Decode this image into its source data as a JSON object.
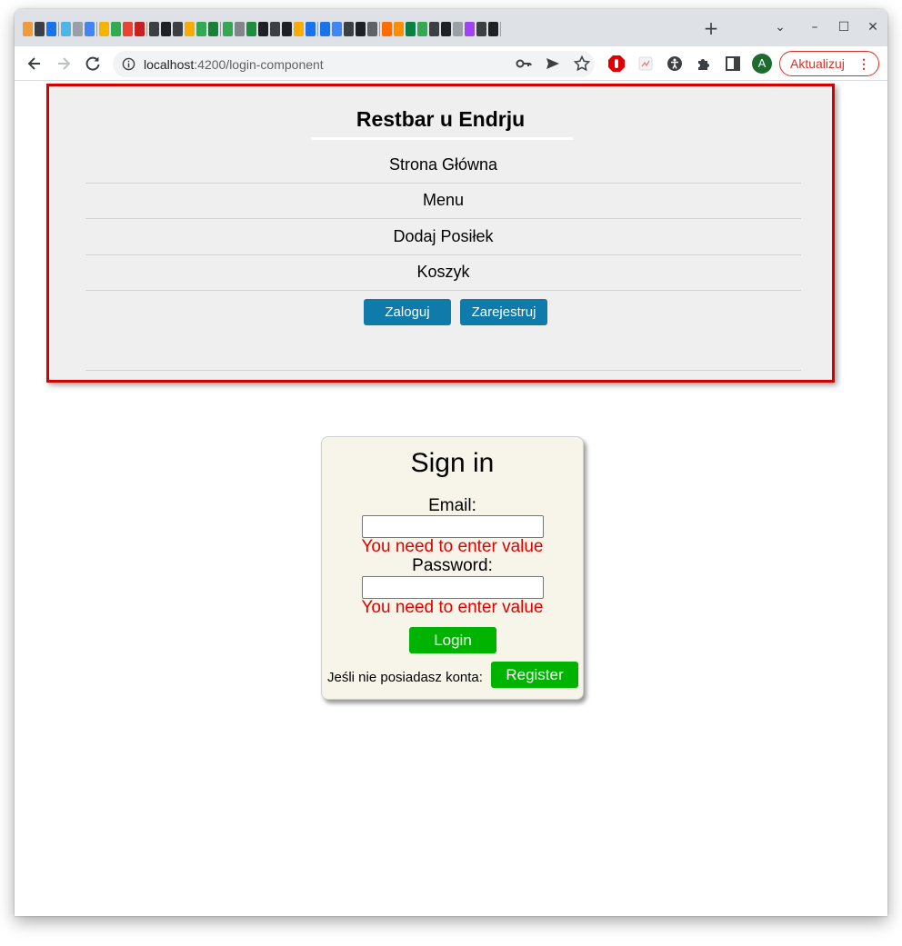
{
  "browser": {
    "new_tab_label": "+",
    "window_controls": {
      "dropdown": "⌄",
      "minimize": "–",
      "maximize": "☐",
      "close": "✕"
    },
    "url_host": "localhost",
    "url_rest": ":4200/login-component",
    "update_button_label": "Aktualizuj",
    "profile_initial": "A"
  },
  "navbar": {
    "brand": "Restbar u Endrju",
    "items": [
      {
        "label": "Strona Główna"
      },
      {
        "label": "Menu"
      },
      {
        "label": "Dodaj Posiłek"
      },
      {
        "label": "Koszyk"
      }
    ],
    "login_label": "Zaloguj",
    "register_label": "Zarejestruj"
  },
  "signin": {
    "title": "Sign in",
    "email_label": "Email:",
    "email_value": "",
    "email_error": "You need to enter value",
    "password_label": "Password:",
    "password_value": "",
    "password_error": "You need to enter value",
    "login_button": "Login",
    "no_account_text": "Jeśli nie posiadasz konta:",
    "register_button": "Register"
  },
  "colors": {
    "nav_border": "#d30000",
    "nav_background": "#efefef",
    "primary_button": "#0e7bab",
    "success_button": "#00b300",
    "error_text": "#e00000",
    "card_background": "#f7f5ea"
  }
}
